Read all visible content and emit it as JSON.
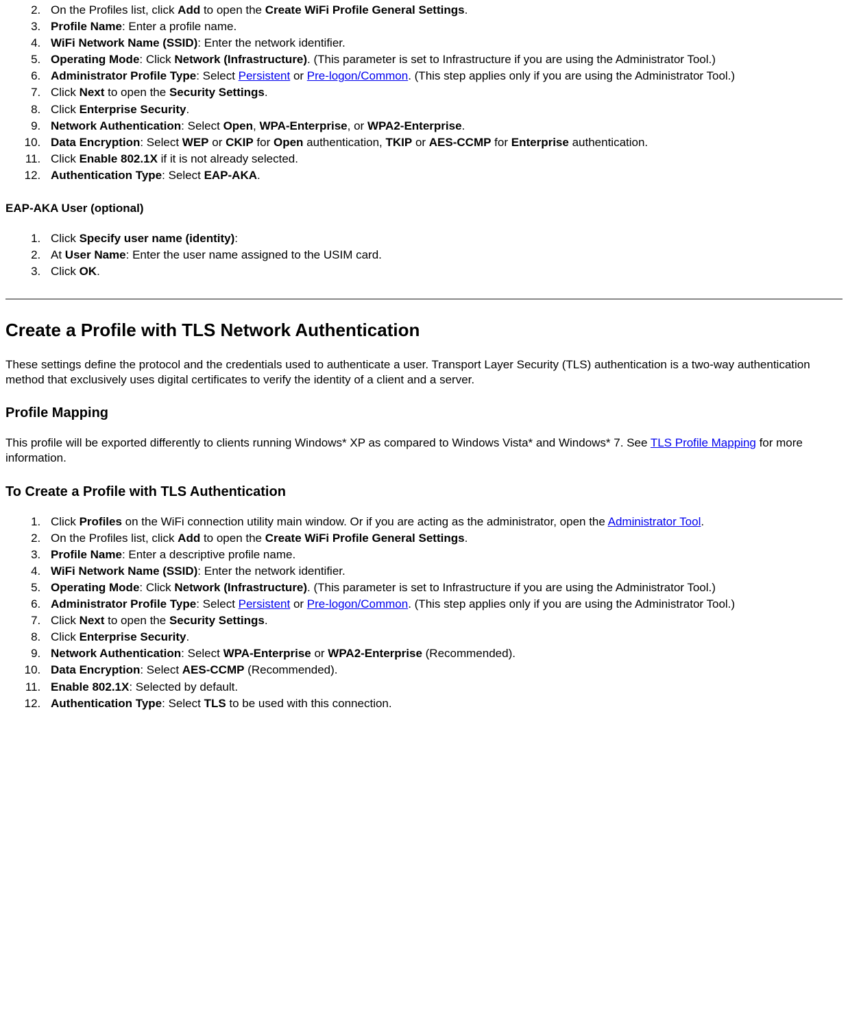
{
  "section1_list": [
    {
      "pre": "On the Profiles list, click ",
      "b1": "Add",
      "mid1": " to open the ",
      "b2": "Create WiFi Profile General Settings",
      "post": "."
    },
    {
      "b1": "Profile Name",
      "post": ": Enter a profile name."
    },
    {
      "b1": "WiFi Network Name (SSID)",
      "post": ": Enter the network identifier."
    },
    {
      "b1": "Operating Mode",
      "mid1": ": Click ",
      "b2": "Network (Infrastructure)",
      "post": ". (This parameter is set to Infrastructure if you are using the Administrator Tool.)"
    },
    {
      "b1": "Administrator Profile Type",
      "mid1": ": Select ",
      "l1": "Persistent",
      "mid2": " or ",
      "l2": "Pre-logon/Common",
      "post": ". (This step applies only if you are using the Administrator Tool.)"
    },
    {
      "pre": "Click ",
      "b1": "Next",
      "mid1": " to open the ",
      "b2": "Security Settings",
      "post": "."
    },
    {
      "pre": "Click ",
      "b1": "Enterprise Security",
      "post": "."
    },
    {
      "b1": "Network Authentication",
      "mid1": ": Select ",
      "b2": "Open",
      "mid2": ", ",
      "b3": "WPA-Enterprise",
      "mid3": ", or ",
      "b4": "WPA2-Enterprise",
      "post": "."
    },
    {
      "b1": "Data Encryption",
      "mid1": ": Select ",
      "b2": "WEP",
      "mid2": " or ",
      "b3": "CKIP",
      "mid3": " for ",
      "b4": "Open",
      "mid4": " authentication, ",
      "b5": "TKIP",
      "mid5": " or ",
      "b6": "AES-CCMP",
      "mid6": " for ",
      "b7": "Enterprise",
      "post": " authentication."
    },
    {
      "pre": "Click ",
      "b1": "Enable 802.1X",
      "post": " if it is not already selected."
    },
    {
      "b1": "Authentication Type",
      "mid1": ": Select ",
      "b2": "EAP-AKA",
      "post": "."
    }
  ],
  "eap_header": "EAP-AKA User (optional)",
  "eap_list": [
    {
      "pre": "Click ",
      "b1": "Specify user name (identity)",
      "post": ":"
    },
    {
      "pre": "At ",
      "b1": "User Name",
      "post": ": Enter the user name assigned to the USIM card."
    },
    {
      "pre": "Click ",
      "b1": "OK",
      "post": "."
    }
  ],
  "tls_h2": "Create a Profile with TLS Network Authentication",
  "tls_para": "These settings define the protocol and the credentials used to authenticate a user. Transport Layer Security (TLS) authentication is a two-way authentication method that exclusively uses digital certificates to verify the identity of a client and a server.",
  "pm_h3": "Profile Mapping",
  "pm_para_pre": "This profile will be exported differently to clients running Windows* XP as compared to Windows Vista* and Windows* 7. See ",
  "pm_link": "TLS Profile Mapping",
  "pm_para_post": " for more information.",
  "tocreate_h3": "To Create a Profile with TLS Authentication",
  "section2_list": [
    {
      "pre": "Click ",
      "b1": "Profiles",
      "mid1": " on the WiFi connection utility main window. Or if you are acting as the administrator, open the ",
      "l1": "Administrator Tool",
      "post": "."
    },
    {
      "pre": "On the Profiles list, click ",
      "b1": "Add",
      "mid1": " to open the ",
      "b2": "Create WiFi Profile General Settings",
      "post": "."
    },
    {
      "b1": "Profile Name",
      "post": ": Enter a descriptive profile name."
    },
    {
      "b1": "WiFi Network Name (SSID)",
      "post": ": Enter the network identifier."
    },
    {
      "b1": "Operating Mode",
      "mid1": ": Click ",
      "b2": "Network (Infrastructure)",
      "post": ". (This parameter is set to Infrastructure if you are using the Administrator Tool.)"
    },
    {
      "b1": "Administrator Profile Type",
      "mid1": ": Select ",
      "l1": "Persistent",
      "mid2": " or ",
      "l2": "Pre-logon/Common",
      "post": ". (This step applies only if you are using the Administrator Tool.)"
    },
    {
      "pre": "Click ",
      "b1": "Next",
      "mid1": " to open the ",
      "b2": "Security Settings",
      "post": "."
    },
    {
      "pre": "Click ",
      "b1": "Enterprise Security",
      "post": "."
    },
    {
      "b1": "Network Authentication",
      "mid1": ": Select ",
      "b2": "WPA-Enterprise",
      "mid2": " or ",
      "b3": "WPA2-Enterprise",
      "post": " (Recommended)."
    },
    {
      "b1": "Data Encryption",
      "mid1": ": Select ",
      "b2": "AES-CCMP",
      "post": " (Recommended)."
    },
    {
      "b1": "Enable 802.1X",
      "post": ": Selected by default."
    },
    {
      "b1": "Authentication Type",
      "mid1": ": Select ",
      "b2": "TLS",
      "post": " to be used with this connection."
    }
  ]
}
